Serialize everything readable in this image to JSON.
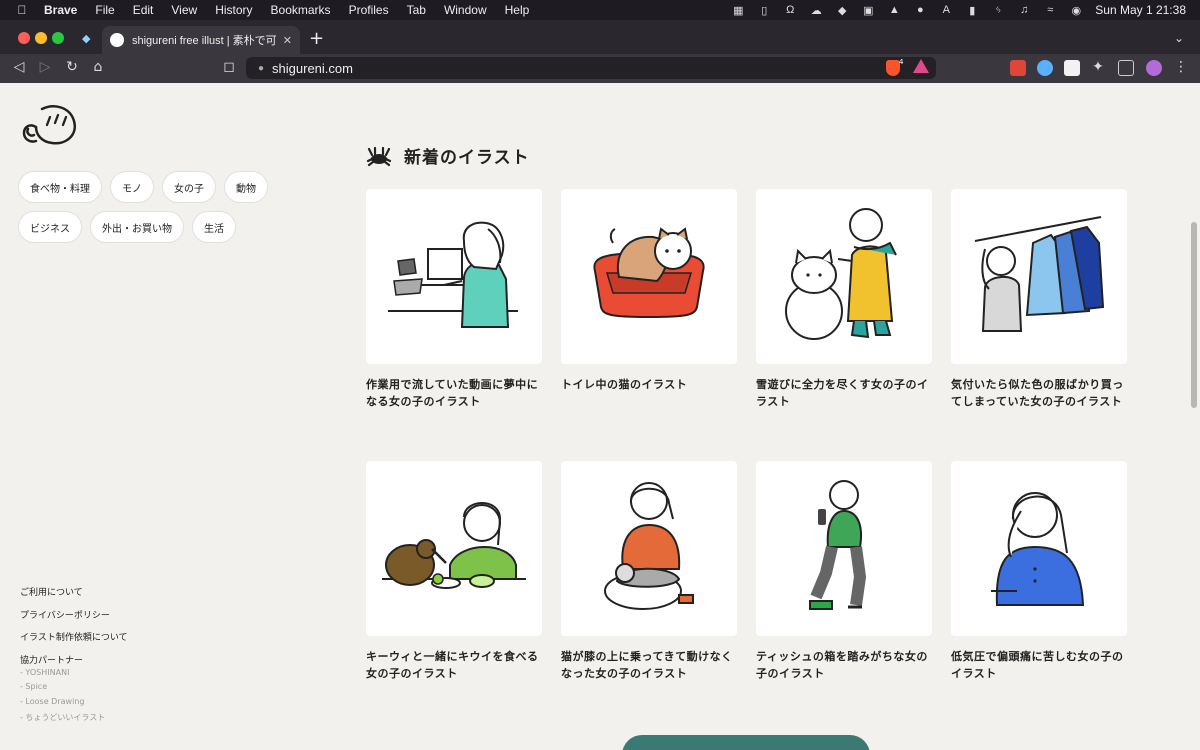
{
  "menubar": {
    "app": "Brave",
    "items": [
      "File",
      "Edit",
      "View",
      "History",
      "Bookmarks",
      "Profiles",
      "Tab",
      "Window",
      "Help"
    ],
    "clock": "Sun May 1  21:38"
  },
  "tab": {
    "title": "shigureni free illust | 素朴で可愛い"
  },
  "address": {
    "url": "shigureni.com",
    "shield_count": "4"
  },
  "sidebar": {
    "categories": [
      "食べ物・料理",
      "モノ",
      "女の子",
      "動物",
      "ビジネス",
      "外出・お買い物",
      "生活"
    ],
    "footer_links": [
      "ご利用について",
      "プライバシーポリシー",
      "イラスト制作依頼について",
      "協力パートナー"
    ],
    "partners": [
      "- YOSHINANI",
      "- Spice",
      "- Loose Drawing",
      "- ちょうどいいイラスト"
    ]
  },
  "section": {
    "title": "新着のイラスト"
  },
  "cards": [
    {
      "title": "作業用で流していた動画に夢中になる女の子のイラスト",
      "icon": "girl-laptop"
    },
    {
      "title": "トイレ中の猫のイラスト",
      "icon": "cat-litter"
    },
    {
      "title": "雪遊びに全力を尽くす女の子のイラスト",
      "icon": "girl-snowcat"
    },
    {
      "title": "気付いたら似た色の服ばかり買ってしまっていた女の子のイラスト",
      "icon": "girl-clothes"
    },
    {
      "title": "キーウィと一緒にキウイを食べる女の子のイラスト",
      "icon": "girl-kiwi"
    },
    {
      "title": "猫が膝の上に乗ってきて動けなくなった女の子のイラスト",
      "icon": "girl-cat-lap"
    },
    {
      "title": "ティッシュの箱を踏みがちな女の子のイラスト",
      "icon": "girl-tissue"
    },
    {
      "title": "低気圧で偏頭痛に苦しむ女の子のイラスト",
      "icon": "girl-headache"
    }
  ],
  "colors": {
    "page_bg": "#f3f1ee",
    "card_bg": "#ffffff",
    "accent": "#3b7a72"
  }
}
